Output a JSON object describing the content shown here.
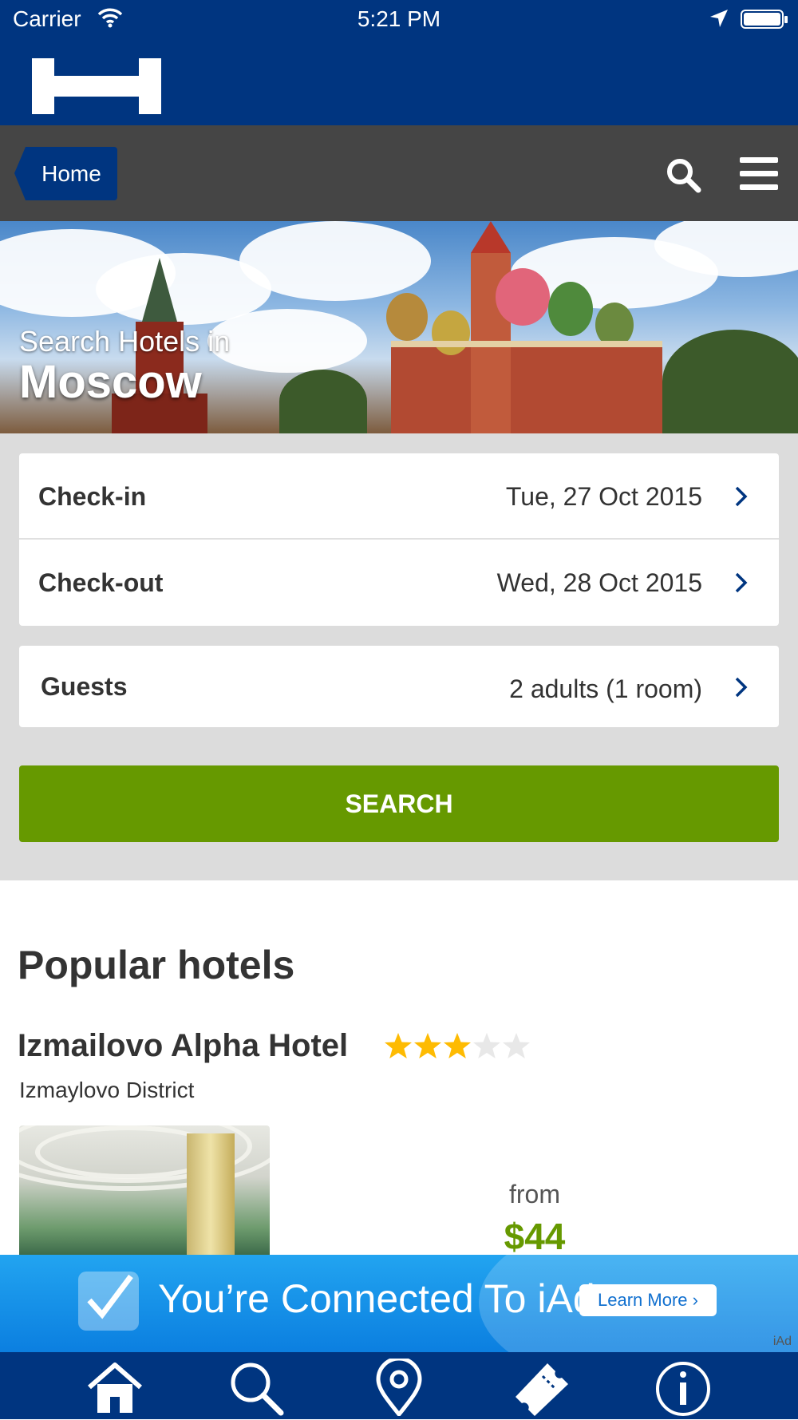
{
  "status_bar": {
    "carrier": "Carrier",
    "time": "5:21 PM",
    "icons": [
      "wifi-icon",
      "location-arrow-icon",
      "battery-icon"
    ]
  },
  "brand": {
    "logo": "H"
  },
  "navbar": {
    "home_label": "Home",
    "icons": [
      "search-icon",
      "menu-icon"
    ]
  },
  "hero": {
    "subtitle": "Search Hotels in",
    "city": "Moscow"
  },
  "search_form": {
    "checkin": {
      "label": "Check-in",
      "value": "Tue, 27 Oct 2015"
    },
    "checkout": {
      "label": "Check-out",
      "value": "Wed, 28 Oct 2015"
    },
    "guests": {
      "label": "Guests",
      "value": "2 adults (1 room)"
    },
    "search_label": "SEARCH"
  },
  "popular": {
    "title": "Popular hotels",
    "hotels": [
      {
        "name": "Izmailovo Alpha Hotel",
        "stars": 3,
        "max_stars": 5,
        "district": "Izmaylovo District",
        "from_label": "from",
        "price": "$44"
      }
    ]
  },
  "ad": {
    "text": "You’re Connected To iAd",
    "button": "Learn More ›",
    "badge": "iAd"
  },
  "tab_bar": {
    "items": [
      "home-icon",
      "search-icon",
      "map-pin-icon",
      "ticket-icon",
      "info-icon"
    ]
  },
  "colors": {
    "brand_blue": "#003580",
    "nav_gray": "#454545",
    "panel_gray": "#dcdcdc",
    "accent_green": "#669900",
    "star_gold": "#febb02"
  }
}
